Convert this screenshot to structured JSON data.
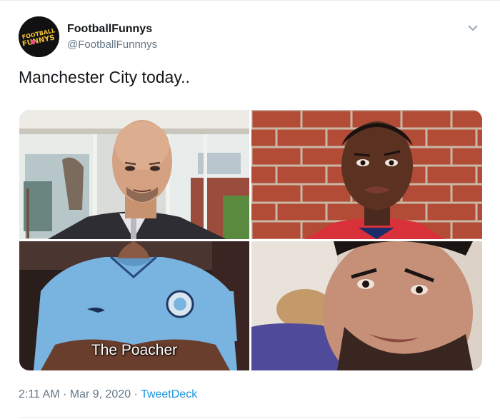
{
  "tweet": {
    "avatar_text": [
      "FOOTBALL",
      "FUNNYS"
    ],
    "display_name": "FootballFunnys",
    "handle": "@FootballFunnnys",
    "text": "Manchester City today..",
    "media": {
      "panel_caption": "The Poacher"
    },
    "time": "2:11 AM",
    "sep1": " · ",
    "date": "Mar 9, 2020",
    "sep2": " · ",
    "source": "TweetDeck"
  },
  "icons": {
    "more": "chevron-down-icon"
  },
  "colors": {
    "link": "#1b95e0",
    "secondary_text": "#657786",
    "border": "#e6ecf0"
  }
}
